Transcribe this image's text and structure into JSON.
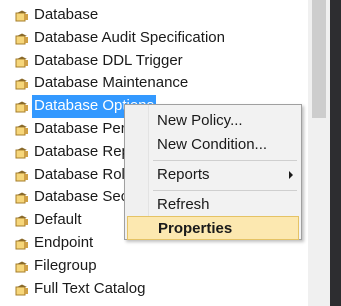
{
  "tree": {
    "items": [
      {
        "label": "Database",
        "icon": "policy-facet-icon"
      },
      {
        "label": "Database Audit Specification",
        "icon": "policy-facet-icon"
      },
      {
        "label": "Database DDL Trigger",
        "icon": "policy-facet-icon"
      },
      {
        "label": "Database Maintenance",
        "icon": "policy-facet-icon"
      },
      {
        "label": "Database Options",
        "icon": "policy-facet-icon",
        "selected": true
      },
      {
        "label": "Database Performance",
        "icon": "policy-facet-icon"
      },
      {
        "label": "Database Replication",
        "icon": "policy-facet-icon"
      },
      {
        "label": "Database Role",
        "icon": "policy-facet-icon"
      },
      {
        "label": "Database Security",
        "icon": "policy-facet-icon"
      },
      {
        "label": "Default",
        "icon": "policy-facet-icon"
      },
      {
        "label": "Endpoint",
        "icon": "policy-facet-icon"
      },
      {
        "label": "Filegroup",
        "icon": "policy-facet-icon"
      },
      {
        "label": "Full Text Catalog",
        "icon": "policy-facet-icon"
      }
    ]
  },
  "context_menu": {
    "new_policy": "New Policy...",
    "new_condition": "New Condition...",
    "reports": "Reports",
    "refresh": "Refresh",
    "properties": "Properties"
  },
  "colors": {
    "selection": "#3399ff",
    "menu_highlight": "#fce8b0",
    "menu_background": "#f2f2f2",
    "scrollbar_thumb": "#cdcdcd",
    "dark_border": "#2d2d30"
  }
}
